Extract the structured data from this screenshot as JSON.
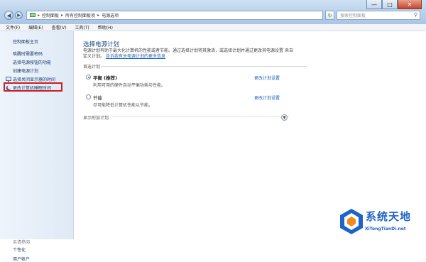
{
  "window": {
    "min_label": "—",
    "max_label": "□",
    "close_label": "✕"
  },
  "address": {
    "back_icon": "back-arrow-icon",
    "forward_icon": "forward-arrow-icon",
    "crumbs": [
      "控制面板",
      "所有控制面板项",
      "电源选项"
    ]
  },
  "search": {
    "placeholder": "搜索控制面板"
  },
  "menu": [
    "文件(F)",
    "编辑(E)",
    "查看(V)",
    "工具(T)",
    "帮助(H)"
  ],
  "sidebar": {
    "home": "控制面板主页",
    "links": [
      "唤醒时需要密码",
      "选择电源按钮的功能",
      "创建电源计划",
      "选择关闭显示器的时间",
      "更改计算机睡眠时间"
    ],
    "see_also": "另请参阅",
    "bottom_links": [
      "个性化",
      "用户帐户"
    ]
  },
  "main": {
    "title": "选择电源计划",
    "desc_1": "电源计划有助于最大化计算机的性能或者节能。通过选择计划将其激活，或选择计划并通过更改其电源设置",
    "desc_2": "来自定义计划。",
    "desc_link": "告诉我有关电源计划的更多信息",
    "group_label": "首选计划",
    "plans": [
      {
        "name": "平衡",
        "tag": "(推荐)",
        "description": "利用可用的硬件自动平衡功耗与性能。",
        "link": "更改计划设置",
        "selected": true
      },
      {
        "name": "节能",
        "tag": "",
        "description": "尽可能降低计算机性能以节能。",
        "link": "更改计划设置",
        "selected": false
      }
    ],
    "show_more": "显示附加计划"
  },
  "watermark": {
    "brand": "系统天地",
    "domain": "XiTongTianDi.net"
  },
  "colors": {
    "accent": "#1e4f8c",
    "link": "#1a5fb4",
    "highlight": "#d21c1c",
    "brand": "#1d63c9"
  }
}
